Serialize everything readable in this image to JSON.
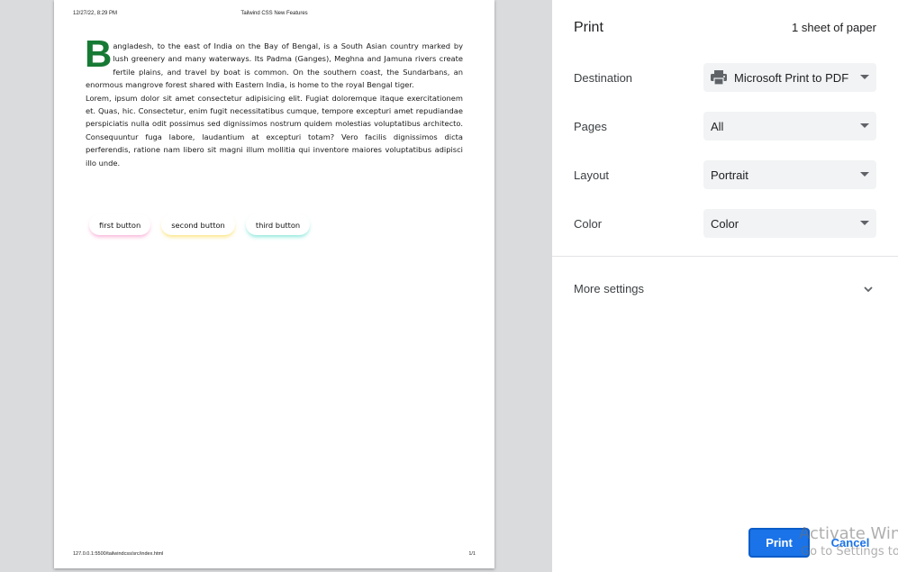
{
  "page": {
    "header_date": "12/27/22, 8:29 PM",
    "header_title": "Tailwind CSS New Features",
    "dropcap": "B",
    "paragraph1": "angladesh, to the east of India on the Bay of Bengal, is a South Asian country marked by lush greenery and many waterways. Its Padma (Ganges), Meghna and Jamuna rivers create fertile plains, and travel by boat is common. On the southern coast, the Sundarbans, an enormous mangrove forest shared with Eastern India, is home to the royal Bengal tiger.",
    "paragraph2": "Lorem, ipsum dolor sit amet consectetur adipisicing elit. Fugiat doloremque itaque exercitationem et. Quas, hic. Consectetur, enim fugit necessitatibus cumque, tempore excepturi amet repudiandae perspiciatis nulla odit possimus sed dignissimos nostrum quidem molestias voluptatibus architecto. Consequuntur fuga labore, laudantium at excepturi totam? Vero facilis dignissimos dicta perferendis, ratione nam libero sit magni illum mollitia qui inventore maiores voluptatibus adipisci illo unde.",
    "buttons": [
      "first button",
      "second button",
      "third button"
    ],
    "footer_url": "127.0.0.1:5500/tailwindcss/src/index.html",
    "footer_page": "1/1"
  },
  "settings": {
    "title": "Print",
    "sheets": "1 sheet of paper",
    "destination": {
      "label": "Destination",
      "value": "Microsoft Print to PDF",
      "icon": "printer-icon"
    },
    "pages": {
      "label": "Pages",
      "value": "All"
    },
    "layout": {
      "label": "Layout",
      "value": "Portrait"
    },
    "color": {
      "label": "Color",
      "value": "Color"
    },
    "more_settings": "More settings",
    "print_button": "Print",
    "cancel_button": "Cancel"
  },
  "watermark": {
    "line1": "Activate Win",
    "line2": "Go to Settings to"
  },
  "colors": {
    "accent": "#1a73e8",
    "dropcap": "#177a34",
    "preview_bg": "#dadbdd"
  }
}
